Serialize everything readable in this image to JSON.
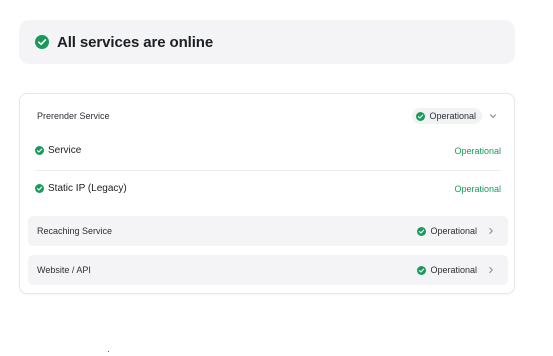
{
  "banner": {
    "title": "All services are online",
    "icon": "check-circle-icon",
    "color": "#1a9a5a"
  },
  "group": {
    "label": "Prerender Service",
    "status": "Operational",
    "expanded": true,
    "subservices": [
      {
        "label": "Service",
        "status": "Operational"
      },
      {
        "label": "Static IP (Legacy)",
        "status": "Operational"
      }
    ]
  },
  "services": [
    {
      "label": "Recaching Service",
      "status": "Operational"
    },
    {
      "label": "Website / API",
      "status": "Operational"
    }
  ],
  "colors": {
    "operational": "#1a9a5a",
    "row_bg": "#f4f4f6",
    "border": "#e6e7ea"
  }
}
